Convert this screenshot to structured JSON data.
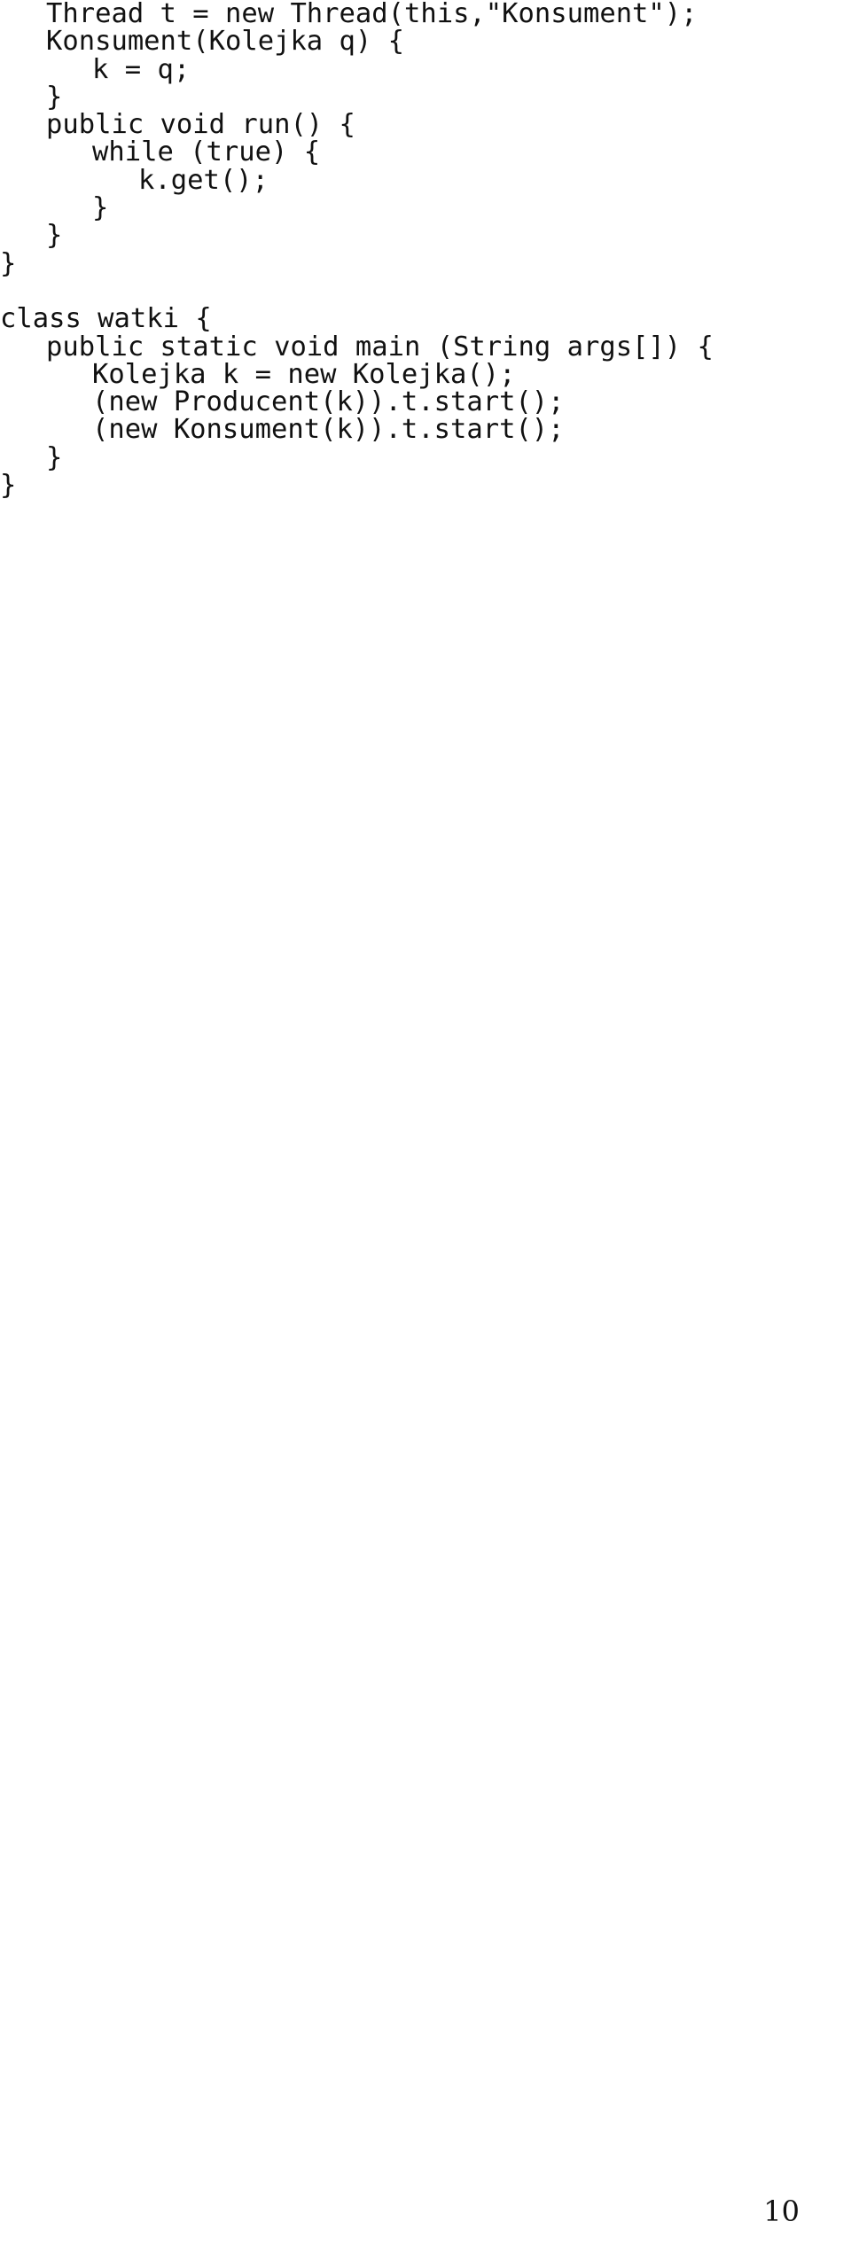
{
  "document": {
    "page_number": "10",
    "language": "java",
    "background_color": "#ffffff",
    "text_color": "#111111"
  },
  "code": {
    "lines": [
      {
        "indent": 2,
        "text": "Thread t = new Thread(this,\"Konsument\");"
      },
      {
        "indent": 2,
        "text": "Konsument(Kolejka q) {"
      },
      {
        "indent": 4,
        "text": "k = q;"
      },
      {
        "indent": 2,
        "text": "}"
      },
      {
        "indent": 2,
        "text": "public void run() {"
      },
      {
        "indent": 4,
        "text": "while (true) {"
      },
      {
        "indent": 6,
        "text": "k.get();"
      },
      {
        "indent": 4,
        "text": "}"
      },
      {
        "indent": 2,
        "text": "}"
      },
      {
        "indent": 0,
        "text": "}"
      },
      {
        "indent": 0,
        "text": ""
      },
      {
        "indent": 0,
        "text": "class watki {"
      },
      {
        "indent": 2,
        "text": "public static void main (String args[]) {"
      },
      {
        "indent": 4,
        "text": "Kolejka k = new Kolejka();"
      },
      {
        "indent": 4,
        "text": "(new Producent(k)).t.start();"
      },
      {
        "indent": 4,
        "text": "(new Konsument(k)).t.start();"
      },
      {
        "indent": 2,
        "text": "}"
      },
      {
        "indent": 0,
        "text": "}"
      }
    ]
  }
}
